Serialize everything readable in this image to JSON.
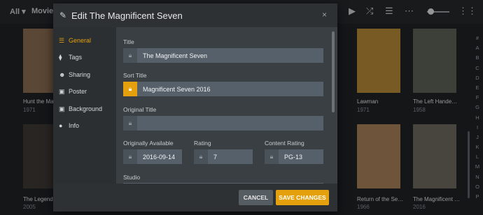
{
  "topbar": {
    "all_label": "All ▾",
    "movies_label": "Movies",
    "icons": [
      "play-icon",
      "shuffle-icon",
      "queue-icon",
      "grid-icon"
    ]
  },
  "library": {
    "posters": [
      {
        "title": "Hunt the Ma…",
        "year": "1971",
        "color": "#8a6d52"
      },
      {
        "title": "The Legend",
        "year": "2005",
        "color": "#3e3a36"
      },
      {
        "title": "Lawman",
        "year": "1971",
        "color": "#b98b3a"
      },
      {
        "title": "The Left Hande…",
        "year": "1958",
        "color": "#5e6258"
      },
      {
        "title": "Return of the Se…",
        "year": "1966",
        "color": "#a8825a"
      },
      {
        "title": "The Magnificent …",
        "year": "2016",
        "color": "#6f6a62"
      }
    ],
    "alphabet": [
      "#",
      "A",
      "B",
      "C",
      "D",
      "E",
      "F",
      "G",
      "H",
      "I",
      "J",
      "K",
      "L",
      "M",
      "N",
      "O",
      "P"
    ]
  },
  "modal": {
    "title": "Edit The Magnificent Seven",
    "close_glyph": "×",
    "nav": [
      {
        "label": "General",
        "icon": "film-icon",
        "glyph": "☰"
      },
      {
        "label": "Tags",
        "icon": "tag-icon",
        "glyph": "⧫"
      },
      {
        "label": "Sharing",
        "icon": "users-icon",
        "glyph": "☻"
      },
      {
        "label": "Poster",
        "icon": "image-icon",
        "glyph": "▣"
      },
      {
        "label": "Background",
        "icon": "image-icon",
        "glyph": "▣"
      },
      {
        "label": "Info",
        "icon": "info-icon",
        "glyph": "●"
      }
    ],
    "fields": {
      "title_label": "Title",
      "title_value": "The Magnificent Seven",
      "sort_title_label": "Sort Title",
      "sort_title_value": "Magnificent Seven 2016",
      "original_title_label": "Original Title",
      "original_title_value": "",
      "orig_avail_label": "Originally Available",
      "orig_avail_value": "2016-09-14",
      "rating_label": "Rating",
      "rating_value": "7",
      "content_rating_label": "Content Rating",
      "content_rating_value": "PG-13",
      "studio_label": "Studio"
    },
    "cancel_label": "CANCEL",
    "save_label": "SAVE CHANGES",
    "accent_color": "#e5a00d"
  }
}
